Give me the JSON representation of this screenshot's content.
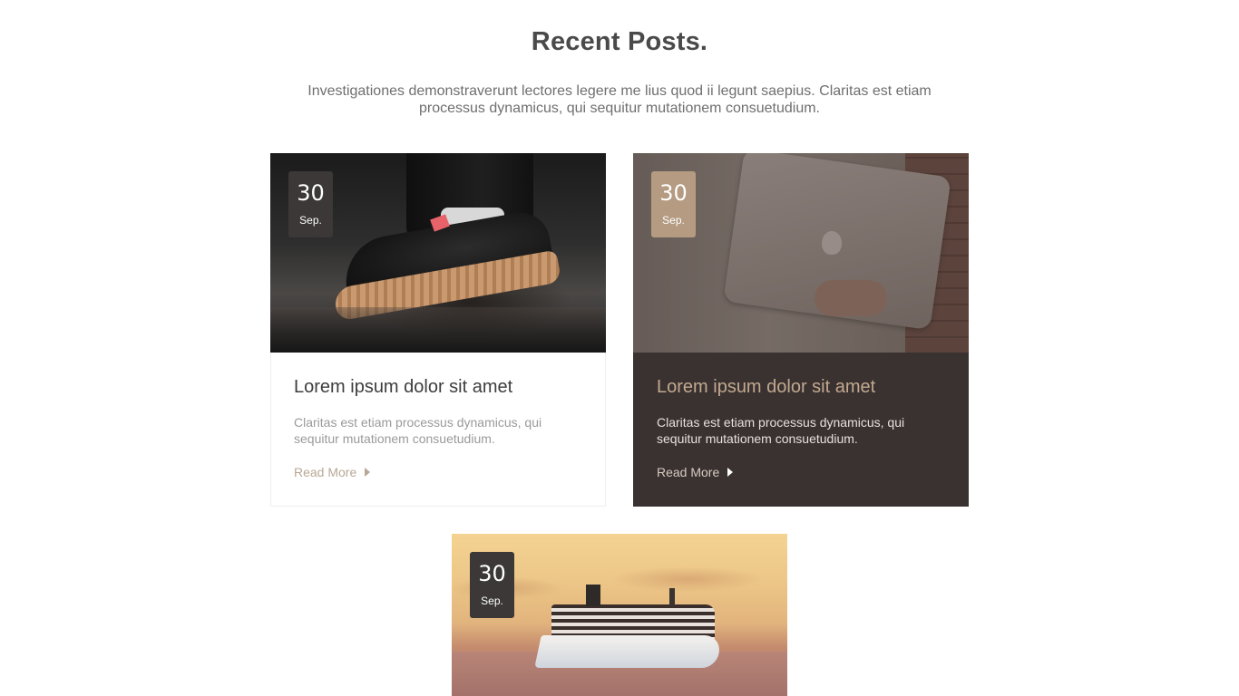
{
  "section": {
    "title": "Recent Posts.",
    "subtitle": "Investigationes demonstraverunt lectores legere me lius quod ii legunt saepius. Claritas est etiam processus dynamicus, qui sequitur mutationem consuetudium."
  },
  "posts": [
    {
      "date_day": "30",
      "date_month": "Sep.",
      "image": "sneaker-photo",
      "title": "Lorem ipsum dolor sit amet",
      "excerpt": "Claritas est etiam processus dynamicus, qui sequitur mutationem consuetudium.",
      "read_more": "Read More",
      "read_more_icon": "caret-right-icon"
    },
    {
      "date_day": "30",
      "date_month": "Sep.",
      "image": "laptop-photo",
      "title": "Lorem ipsum dolor sit amet",
      "excerpt": "Claritas est etiam processus dynamicus, qui sequitur mutationem consuetudium.",
      "read_more": "Read More",
      "read_more_icon": "caret-right-icon",
      "highlighted": true
    },
    {
      "date_day": "30",
      "date_month": "Sep.",
      "image": "cruise-ship-photo"
    }
  ],
  "colors": {
    "title": "#4a4a4a",
    "accent": "#b49b82",
    "highlight_card_bg": "#3a3231",
    "badge_bg": "#3b3837"
  }
}
